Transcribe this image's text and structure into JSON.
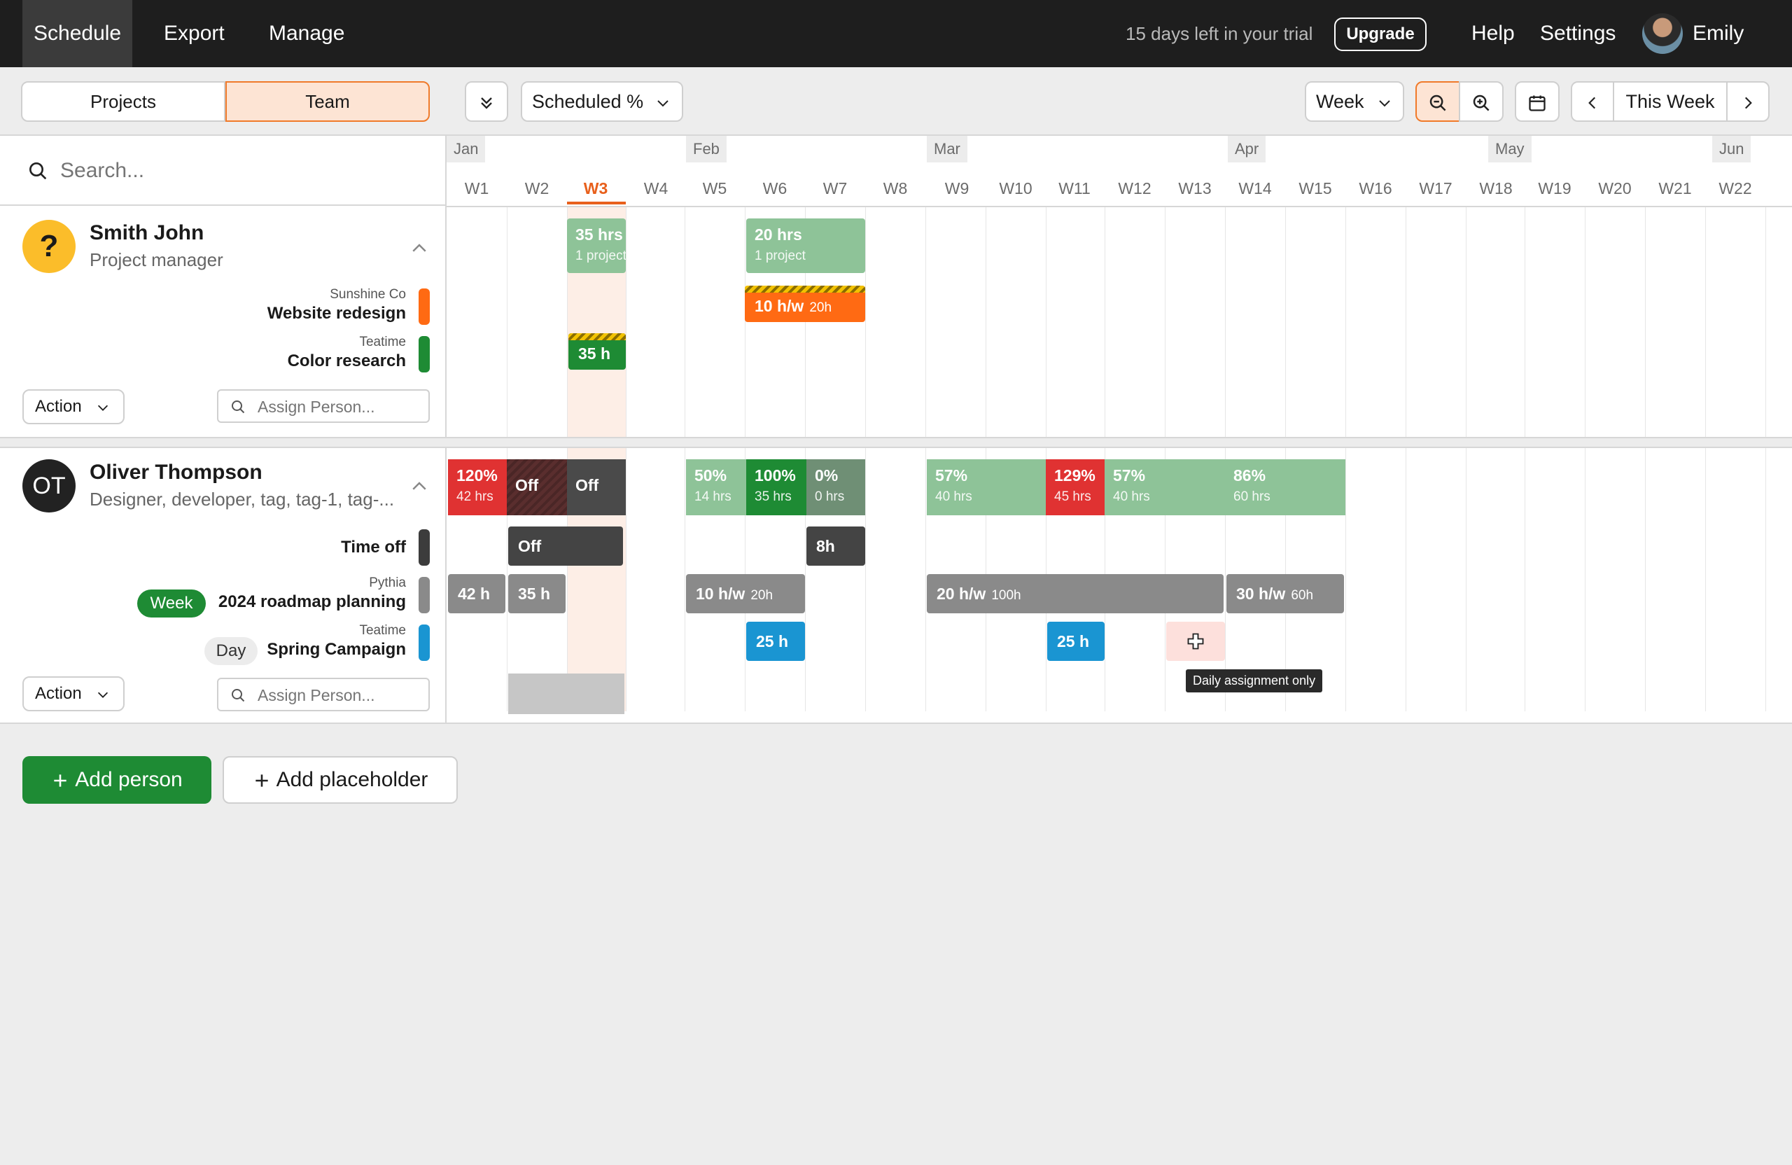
{
  "nav": {
    "schedule": "Schedule",
    "export": "Export",
    "manage": "Manage",
    "trial": "15 days left in your trial",
    "upgrade": "Upgrade",
    "help": "Help",
    "settings": "Settings",
    "user": "Emily"
  },
  "toolbar": {
    "projects": "Projects",
    "team": "Team",
    "metric": "Scheduled %",
    "period": "Week",
    "this_week": "This Week"
  },
  "search": {
    "placeholder": "Search..."
  },
  "timeline": {
    "months": [
      "Jan",
      "Feb",
      "Mar",
      "Apr",
      "May",
      "Jun"
    ],
    "weeks": [
      "W1",
      "W2",
      "W3",
      "W4",
      "W5",
      "W6",
      "W7",
      "W8",
      "W9",
      "W10",
      "W11",
      "W12",
      "W13",
      "W14",
      "W15",
      "W16",
      "W17",
      "W18",
      "W19",
      "W20",
      "W21",
      "W22"
    ],
    "current_week": "W3"
  },
  "people": [
    {
      "avatar": "?",
      "name": "Smith John",
      "role": "Project manager",
      "projects": [
        {
          "client": "Sunshine Co",
          "name": "Website redesign",
          "color": "#ff6a13"
        },
        {
          "client": "Teatime",
          "name": "Color research",
          "color": "#1e8b34"
        }
      ],
      "summary": [
        {
          "main": "35 hrs",
          "sub": "1 project"
        },
        {
          "main": "20 hrs",
          "sub": "1 project"
        }
      ],
      "assignments": [
        {
          "label": "10 h/w",
          "sub": "20h"
        },
        {
          "label": "35 h"
        }
      ]
    },
    {
      "avatar": "OT",
      "name": "Oliver Thompson",
      "role": "Designer, developer, tag, tag-1, tag-...",
      "projects": [
        {
          "client": "",
          "name": "Time off",
          "color": "#3c3c3c"
        },
        {
          "client": "Pythia",
          "name": "2024 roadmap planning",
          "tag": "Week",
          "color": "#8a8a8a"
        },
        {
          "client": "Teatime",
          "name": "Spring Campaign",
          "tag": "Day",
          "color": "#1a95d2"
        }
      ],
      "summary": [
        {
          "main": "120%",
          "sub": "42 hrs"
        },
        {
          "main": "Off"
        },
        {
          "main": "Off"
        },
        {
          "main": "50%",
          "sub": "14 hrs"
        },
        {
          "main": "100%",
          "sub": "35 hrs"
        },
        {
          "main": "0%",
          "sub": "0 hrs"
        },
        {
          "main": "57%",
          "sub": "40 hrs"
        },
        {
          "main": "129%",
          "sub": "45 hrs"
        },
        {
          "main": "57%",
          "sub": "40 hrs"
        },
        {
          "main": "86%",
          "sub": "60 hrs"
        }
      ],
      "timeoff": [
        {
          "label": "Off"
        },
        {
          "label": "8h"
        }
      ],
      "roadmap": [
        {
          "label": "42 h"
        },
        {
          "label": "35 h"
        },
        {
          "label": "10 h/w",
          "sub": "20h"
        },
        {
          "label": "20 h/w",
          "sub": "100h"
        },
        {
          "label": "30 h/w",
          "sub": "60h"
        }
      ],
      "campaign": [
        {
          "label": "25 h"
        },
        {
          "label": "25 h"
        }
      ],
      "tooltip": "Daily assignment only"
    }
  ],
  "actions": {
    "action": "Action",
    "assign_placeholder": "Assign Person..."
  },
  "footer": {
    "add_person": "Add person",
    "add_placeholder": "Add placeholder"
  }
}
